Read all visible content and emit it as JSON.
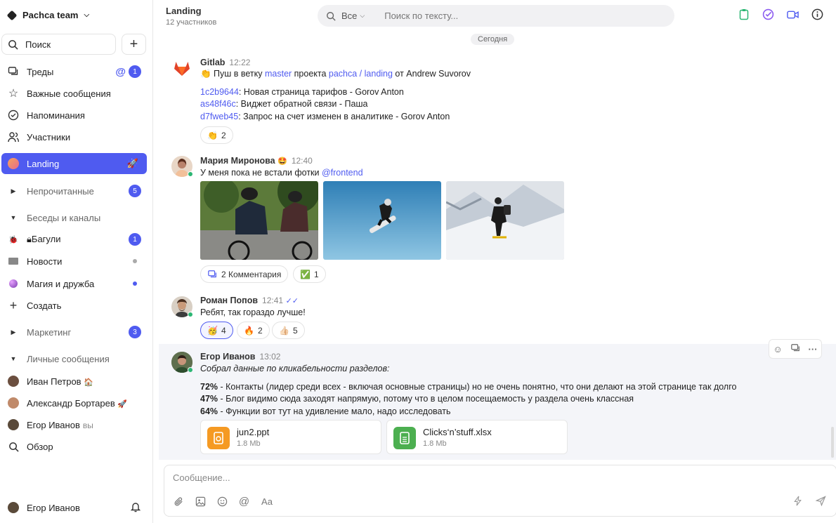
{
  "sidebar": {
    "team_name": "Pachca team",
    "search_label": "Поиск",
    "items": [
      {
        "label": "Треды"
      },
      {
        "label": "Важные сообщения"
      },
      {
        "label": "Напоминания"
      },
      {
        "label": "Участники"
      },
      {
        "label": "Landing"
      },
      {
        "label": "Непрочитанные",
        "badge": "5"
      },
      {
        "label": "Беседы и каналы"
      },
      {
        "label": "Багули",
        "badge": "1"
      },
      {
        "label": "Новости"
      },
      {
        "label": "Магия и дружба"
      },
      {
        "label": "Создать"
      },
      {
        "label": "Маркетинг",
        "badge": "3"
      },
      {
        "label": "Личные сообщения"
      },
      {
        "label": "Иван Петров",
        "emoji": "🏠"
      },
      {
        "label": "Александр Бортарев",
        "emoji": "🚀"
      },
      {
        "label": "Егор Иванов",
        "suffix": "вы"
      },
      {
        "label": "Обзор"
      }
    ],
    "threads_badge": "1",
    "current_user": "Егор Иванов"
  },
  "header": {
    "title": "Landing",
    "subtitle": "12 участников",
    "search_scope": "Все",
    "search_placeholder": "Поиск по тексту..."
  },
  "date_divider": "Сегодня",
  "messages": [
    {
      "author": "Gitlab",
      "time": "12:22",
      "line1_pre": "👏 Пуш в ветку ",
      "branch": "master",
      "line1_mid": " проекта ",
      "project": "pachca / landing",
      "line1_post": " от Andrew Suvorov",
      "commits": [
        {
          "hash": "1c2b9644",
          "text": ": Новая страница тарифов - Gorov Anton"
        },
        {
          "hash": "as48f46c",
          "text": ": Виджет обратной связи - Паша"
        },
        {
          "hash": "d7fweb45",
          "text": ": Запрос на счет изменен в аналитике - Gorov Anton"
        }
      ],
      "reactions": [
        {
          "emoji": "👏",
          "count": "2"
        }
      ]
    },
    {
      "author": "Мария Миронова",
      "author_emoji": "🤩",
      "time": "12:40",
      "text_pre": "У меня пока не встали фотки ",
      "mention": "@frontend",
      "comments_label": "2 Комментария",
      "reactions": [
        {
          "emoji": "✅",
          "count": "1"
        }
      ]
    },
    {
      "author": "Роман Попов",
      "time": "12:41",
      "text": "Ребят, так гораздо лучше!",
      "reactions": [
        {
          "emoji": "🥳",
          "count": "4"
        },
        {
          "emoji": "🔥",
          "count": "2"
        },
        {
          "emoji": "👍🏻",
          "count": "5"
        }
      ]
    },
    {
      "author": "Егор Иванов",
      "time": "13:02",
      "intro": "Собрал данные по кликабельности разделов:",
      "stats": [
        {
          "pct": "72%",
          "text": " - Контакты (лидер среди всех - включая основные страницы) но не очень понятно, что они делают на этой странице так долго"
        },
        {
          "pct": "47%",
          "text": " - Блог видимо сюда заходят напрямую, потому что в целом посещаемость у раздела очень классная"
        },
        {
          "pct": "64%",
          "text": " - Функции вот тут на удивление мало, надо исследовать"
        }
      ],
      "files": [
        {
          "name": "jun2.ppt",
          "size": "1.8 Mb",
          "color": "#f59a23"
        },
        {
          "name": "Clicks‘n’stuff.xlsx",
          "size": "1.8 Mb",
          "color": "#4caf50"
        }
      ]
    }
  ],
  "composer": {
    "placeholder": "Сообщение..."
  },
  "colors": {
    "accent": "#4f5bf0"
  }
}
